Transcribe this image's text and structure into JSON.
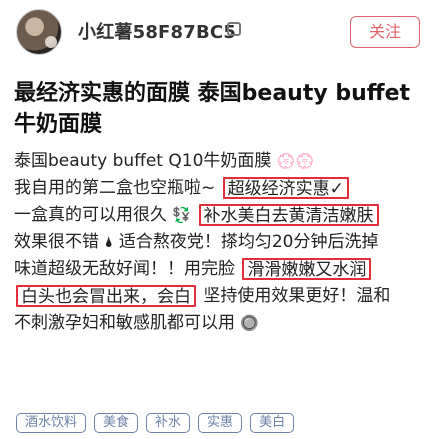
{
  "header": {
    "username": "小红薯58F87BC5",
    "follow_label": "关注"
  },
  "post": {
    "title": "最经济实惠的面膜 泰国beauty buffet牛奶面膜",
    "lines": [
      {
        "pre": "泰国beauty buffet Q10牛奶面膜",
        "emoji": "💮💮"
      },
      {
        "pre": "我自用的第二盒也空瓶啦~",
        "hl": "超级经济实惠✓"
      },
      {
        "pre": "一盒真的可以用很久",
        "emoji": "💱",
        "hl": "补水美白去黄清洁嫩肤"
      },
      {
        "pre": "效果很不错",
        "emoji": "🌢",
        "mid": "适合熬夜党！搽均匀20分钟后洗掉"
      },
      {
        "pre": "味道超级无敌好闻！！用完脸",
        "hl": "滑滑嫩嫩又水润"
      },
      {
        "hl": "白头也会冒出来，会白",
        "mid": "坚持使用效果更好！温和"
      },
      {
        "pre": "不刺激孕妇和敏感肌都可以用",
        "emoji": "🔘"
      }
    ]
  },
  "tags": [
    "酒水饮料",
    "美食",
    "补水",
    "实惠",
    "美白"
  ]
}
